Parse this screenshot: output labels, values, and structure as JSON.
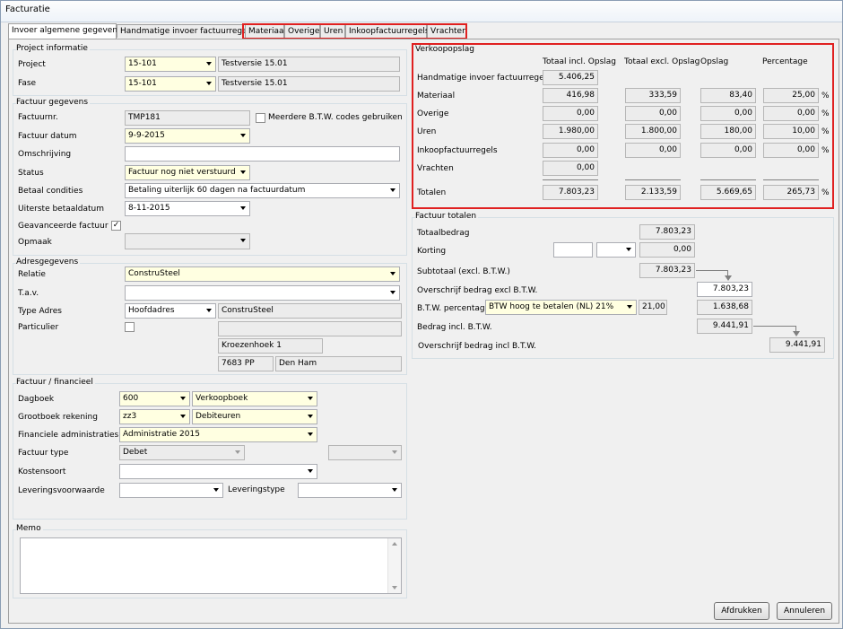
{
  "window": {
    "title": "Facturatie"
  },
  "tabs": [
    "Invoer algemene gegevens",
    "Handmatige invoer factuurregels",
    "Materiaal",
    "Overige",
    "Uren",
    "Inkoopfactuurregels",
    "Vrachten"
  ],
  "project": {
    "title": "Project informatie",
    "project_label": "Project",
    "project_value": "15-101",
    "project_desc": "Testversie 15.01",
    "fase_label": "Fase",
    "fase_value": "15-101",
    "fase_desc": "Testversie 15.01"
  },
  "factuur": {
    "title": "Factuur gegevens",
    "nr_label": "Factuurnr.",
    "nr_value": "TMP181",
    "multi_btw_label": "Meerdere B.T.W. codes gebruiken",
    "datum_label": "Factuur datum",
    "datum_value": "9-9-2015",
    "omschrijving_label": "Omschrijving",
    "omschrijving_value": "",
    "status_label": "Status",
    "status_value": "Factuur nog niet verstuurd",
    "betaal_label": "Betaal condities",
    "betaal_value": "Betaling uiterlijk 60 dagen na factuurdatum",
    "uiterste_label": "Uiterste betaaldatum",
    "uiterste_value": "8-11-2015",
    "geavanceerd_label": "Geavanceerde factuur",
    "geavanceerd_checked": "✓",
    "opmaak_label": "Opmaak",
    "opmaak_value": ""
  },
  "adres": {
    "title": "Adresgegevens",
    "relatie_label": "Relatie",
    "relatie_value": "ConstruSteel",
    "tav_label": "T.a.v.",
    "tav_value": "",
    "type_label": "Type Adres",
    "type_value": "Hoofdadres",
    "type_name": "ConstruSteel",
    "particulier_label": "Particulier",
    "street": "Kroezenhoek 1",
    "postcode": "7683 PP",
    "city": "Den Ham"
  },
  "financieel": {
    "title": "Factuur / financieel",
    "dagboek_label": "Dagboek",
    "dagboek_value": "600",
    "dagboek_desc": "Verkoopboek",
    "grootboek_label": "Grootboek rekening",
    "grootboek_value": "zz3",
    "grootboek_desc": "Debiteuren",
    "admin_label": "Financiele administraties",
    "admin_value": "Administratie 2015",
    "type_label": "Factuur type",
    "type_value": "Debet",
    "kosten_label": "Kostensoort",
    "kosten_value": "",
    "voorwaarde_label": "Leveringsvoorwaarde",
    "leveringstype_label": "Leveringstype"
  },
  "memo": {
    "title": "Memo",
    "value": ""
  },
  "verkoop": {
    "title": "Verkoopopslag",
    "col_incl": "Totaal incl. Opslag",
    "col_excl": "Totaal excl. Opslag",
    "col_opslag": "Opslag",
    "col_pct": "Percentage",
    "pct_sign": "%",
    "rows": [
      {
        "label": "Handmatige invoer factuurregels",
        "incl": "5.406,25"
      },
      {
        "label": "Materiaal",
        "incl": "416,98",
        "excl": "333,59",
        "opslag": "83,40",
        "pct": "25,00"
      },
      {
        "label": "Overige",
        "incl": "0,00",
        "excl": "0,00",
        "opslag": "0,00",
        "pct": "0,00"
      },
      {
        "label": "Uren",
        "incl": "1.980,00",
        "excl": "1.800,00",
        "opslag": "180,00",
        "pct": "10,00"
      },
      {
        "label": "Inkoopfactuurregels",
        "incl": "0,00",
        "excl": "0,00",
        "opslag": "0,00",
        "pct": "0,00"
      },
      {
        "label": "Vrachten",
        "incl": "0,00"
      },
      {
        "label": "Totalen",
        "incl": "7.803,23",
        "excl": "2.133,59",
        "opslag": "5.669,65",
        "pct": "265,73"
      }
    ]
  },
  "totalen": {
    "title": "Factuur totalen",
    "totaalbedrag_label": "Totaalbedrag",
    "totaalbedrag": "7.803,23",
    "korting_label": "Korting",
    "korting": "0,00",
    "subtotaal_label": "Subtotaal (excl. B.T.W.)",
    "subtotaal": "7.803,23",
    "overschrijf_excl_label": "Overschrijf bedrag excl B.T.W.",
    "overschrijf_excl": "7.803,23",
    "btw_label": "B.T.W. percentage",
    "btw_value": "BTW hoog te betalen (NL) 21%",
    "btw_pct": "21,00",
    "btw_amount": "1.638,68",
    "incl_label": "Bedrag incl. B.T.W.",
    "incl": "9.441,91",
    "overschrijf_incl_label": "Overschrijf bedrag incl B.T.W.",
    "overschrijf_incl": "9.441,91"
  },
  "buttons": {
    "print": "Afdrukken",
    "cancel": "Annuleren"
  },
  "colors": {
    "highlight_border": "#e02020",
    "required_field": "#ffffe1"
  }
}
